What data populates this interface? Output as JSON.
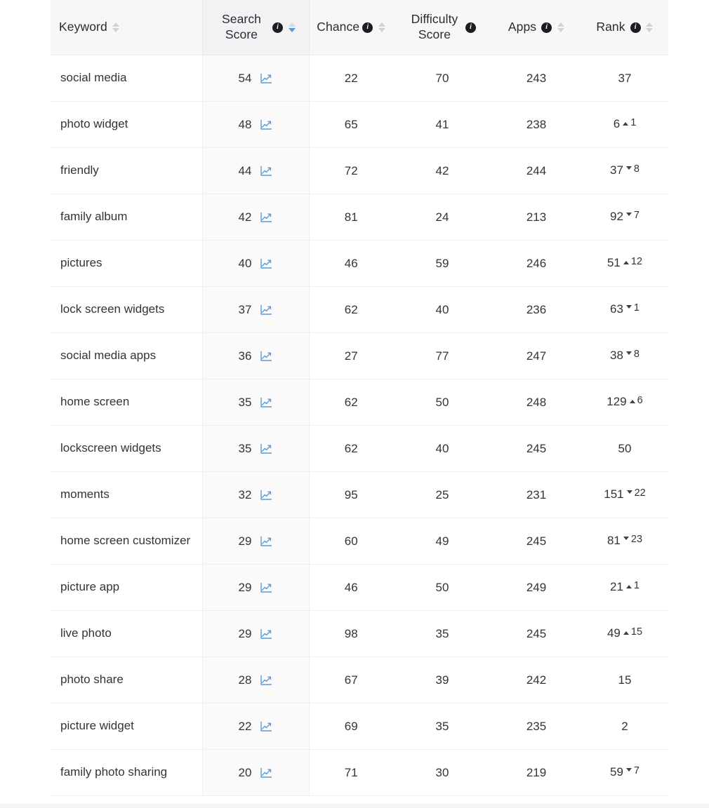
{
  "table": {
    "columns": [
      {
        "id": "keyword",
        "label": "Keyword",
        "has_info": false,
        "sortable": true,
        "sort_state": "none",
        "align": "left"
      },
      {
        "id": "search",
        "label": "Search Score",
        "has_info": true,
        "sortable": true,
        "sort_state": "desc",
        "align": "center"
      },
      {
        "id": "chance",
        "label": "Chance",
        "has_info": true,
        "sortable": true,
        "sort_state": "none",
        "align": "center"
      },
      {
        "id": "difficulty",
        "label": "Difficulty Score",
        "has_info": true,
        "sortable": false,
        "sort_state": "none",
        "align": "center"
      },
      {
        "id": "apps",
        "label": "Apps",
        "has_info": true,
        "sortable": true,
        "sort_state": "none",
        "align": "center"
      },
      {
        "id": "rank",
        "label": "Rank",
        "has_info": true,
        "sortable": true,
        "sort_state": "none",
        "align": "center"
      }
    ],
    "icons": {
      "info": "info-icon",
      "sort": "sort-chevrons-icon",
      "trend_chart": "line-chart-icon",
      "rank_up": "arrow-up-icon",
      "rank_down": "arrow-down-icon"
    },
    "colors": {
      "chart_icon": "#5b9bd5",
      "sort_active": "#5b9bd5",
      "sort_inactive": "#cfd2d8",
      "info_badge": "#1c1c22",
      "text": "#33333a",
      "header_bg": "#f7f7f8",
      "sorted_col_bg": "#fafafb",
      "row_border": "#efeff1"
    },
    "rows": [
      {
        "keyword": "social media",
        "search_score": "54",
        "chance": "22",
        "difficulty": "70",
        "apps": "243",
        "rank": "37",
        "rank_delta": "",
        "rank_dir": "none"
      },
      {
        "keyword": "photo widget",
        "search_score": "48",
        "chance": "65",
        "difficulty": "41",
        "apps": "238",
        "rank": "6",
        "rank_delta": "1",
        "rank_dir": "up"
      },
      {
        "keyword": "friendly",
        "search_score": "44",
        "chance": "72",
        "difficulty": "42",
        "apps": "244",
        "rank": "37",
        "rank_delta": "8",
        "rank_dir": "down"
      },
      {
        "keyword": "family album",
        "search_score": "42",
        "chance": "81",
        "difficulty": "24",
        "apps": "213",
        "rank": "92",
        "rank_delta": "7",
        "rank_dir": "down"
      },
      {
        "keyword": "pictures",
        "search_score": "40",
        "chance": "46",
        "difficulty": "59",
        "apps": "246",
        "rank": "51",
        "rank_delta": "12",
        "rank_dir": "up"
      },
      {
        "keyword": "lock screen widgets",
        "search_score": "37",
        "chance": "62",
        "difficulty": "40",
        "apps": "236",
        "rank": "63",
        "rank_delta": "1",
        "rank_dir": "down"
      },
      {
        "keyword": "social media apps",
        "search_score": "36",
        "chance": "27",
        "difficulty": "77",
        "apps": "247",
        "rank": "38",
        "rank_delta": "8",
        "rank_dir": "down"
      },
      {
        "keyword": "home screen",
        "search_score": "35",
        "chance": "62",
        "difficulty": "50",
        "apps": "248",
        "rank": "129",
        "rank_delta": "6",
        "rank_dir": "up"
      },
      {
        "keyword": "lockscreen widgets",
        "search_score": "35",
        "chance": "62",
        "difficulty": "40",
        "apps": "245",
        "rank": "50",
        "rank_delta": "",
        "rank_dir": "none"
      },
      {
        "keyword": "moments",
        "search_score": "32",
        "chance": "95",
        "difficulty": "25",
        "apps": "231",
        "rank": "151",
        "rank_delta": "22",
        "rank_dir": "down"
      },
      {
        "keyword": "home screen customizer",
        "search_score": "29",
        "chance": "60",
        "difficulty": "49",
        "apps": "245",
        "rank": "81",
        "rank_delta": "23",
        "rank_dir": "down"
      },
      {
        "keyword": "picture app",
        "search_score": "29",
        "chance": "46",
        "difficulty": "50",
        "apps": "249",
        "rank": "21",
        "rank_delta": "1",
        "rank_dir": "up"
      },
      {
        "keyword": "live photo",
        "search_score": "29",
        "chance": "98",
        "difficulty": "35",
        "apps": "245",
        "rank": "49",
        "rank_delta": "15",
        "rank_dir": "up"
      },
      {
        "keyword": "photo share",
        "search_score": "28",
        "chance": "67",
        "difficulty": "39",
        "apps": "242",
        "rank": "15",
        "rank_delta": "",
        "rank_dir": "none"
      },
      {
        "keyword": "picture widget",
        "search_score": "22",
        "chance": "69",
        "difficulty": "35",
        "apps": "235",
        "rank": "2",
        "rank_delta": "",
        "rank_dir": "none"
      },
      {
        "keyword": "family photo sharing",
        "search_score": "20",
        "chance": "71",
        "difficulty": "30",
        "apps": "219",
        "rank": "59",
        "rank_delta": "7",
        "rank_dir": "down"
      }
    ]
  }
}
